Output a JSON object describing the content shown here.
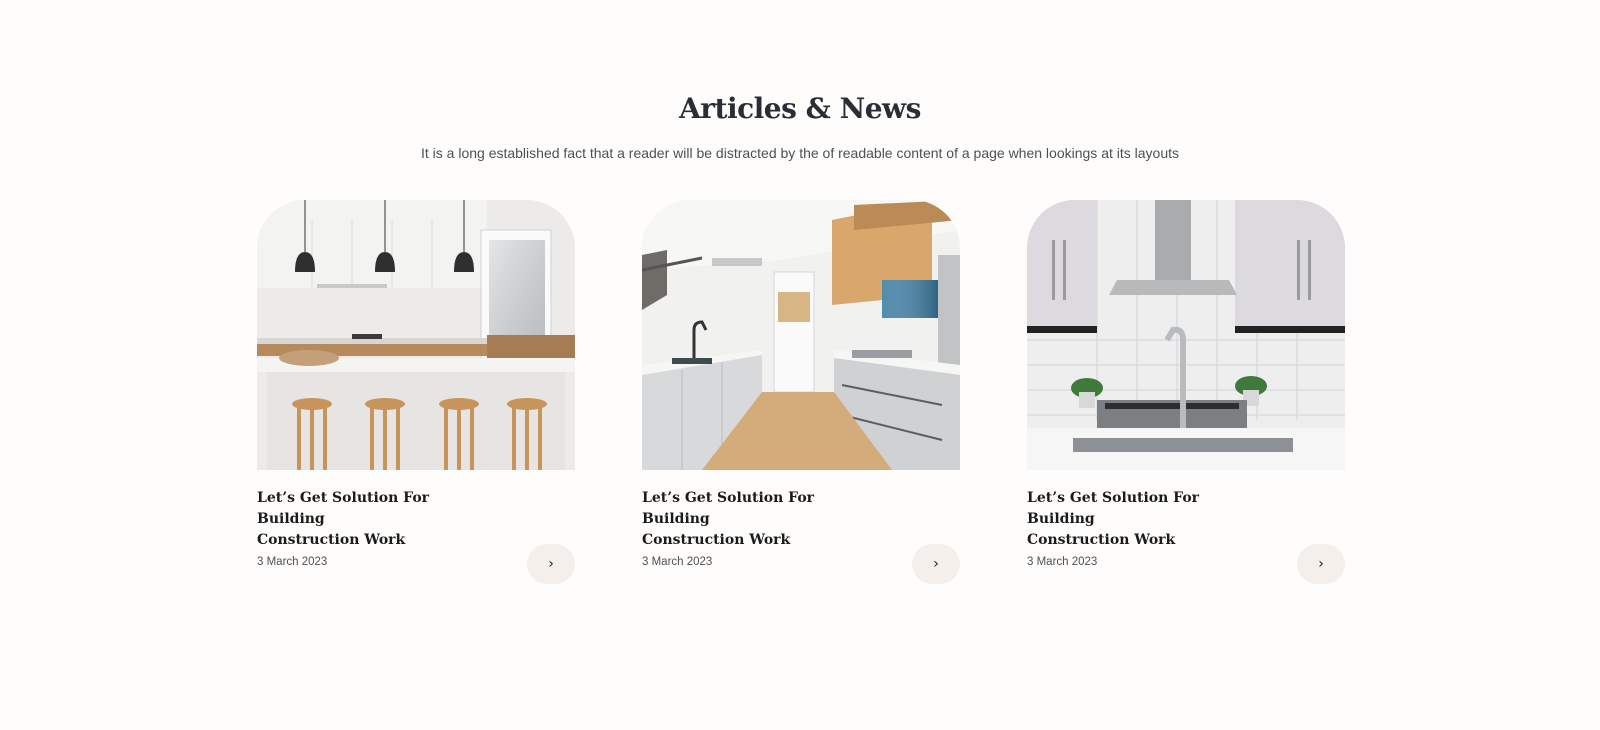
{
  "section": {
    "title": "Articles & News",
    "subtitle": "It is a long established fact that a reader will be distracted by the of readable content of a page when lookings at its layouts"
  },
  "articles": [
    {
      "title_line1": "Let’s Get Solution For Building",
      "title_line2": "Construction Work",
      "date": "3 March 2023",
      "image": "kitchen-island-with-stools-photo",
      "arrow_icon": "chevron-right-icon"
    },
    {
      "title_line1": "Let’s Get Solution For Building",
      "title_line2": "Construction Work",
      "date": "3 March 2023",
      "image": "galley-kitchen-corridor-photo",
      "arrow_icon": "chevron-right-icon"
    },
    {
      "title_line1": "Let’s Get Solution For Building",
      "title_line2": "Construction Work",
      "date": "3 March 2023",
      "image": "kitchen-sink-range-hood-photo",
      "arrow_icon": "chevron-right-icon"
    }
  ],
  "colors": {
    "background": "#fefdfc",
    "heading": "#292e36",
    "button_bg": "#f4efea"
  }
}
